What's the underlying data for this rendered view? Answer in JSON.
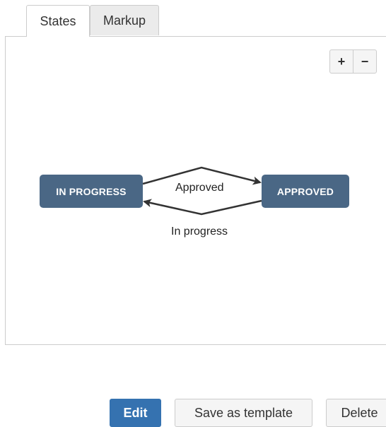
{
  "tabs": [
    {
      "label": "States",
      "active": true
    },
    {
      "label": "Markup",
      "active": false
    }
  ],
  "zoom": {
    "in_label": "+",
    "out_label": "−"
  },
  "diagram": {
    "states": [
      {
        "label": "IN PROGRESS"
      },
      {
        "label": "APPROVED"
      }
    ],
    "transitions": [
      {
        "label": "Approved",
        "from": "IN PROGRESS",
        "to": "APPROVED"
      },
      {
        "label": "In progress",
        "from": "APPROVED",
        "to": "IN PROGRESS"
      }
    ],
    "state_color": "#4a6785"
  },
  "actions": {
    "edit_label": "Edit",
    "save_template_label": "Save as template",
    "delete_label": "Delete"
  },
  "colors": {
    "primary": "#3572b0",
    "border": "#cccccc"
  }
}
